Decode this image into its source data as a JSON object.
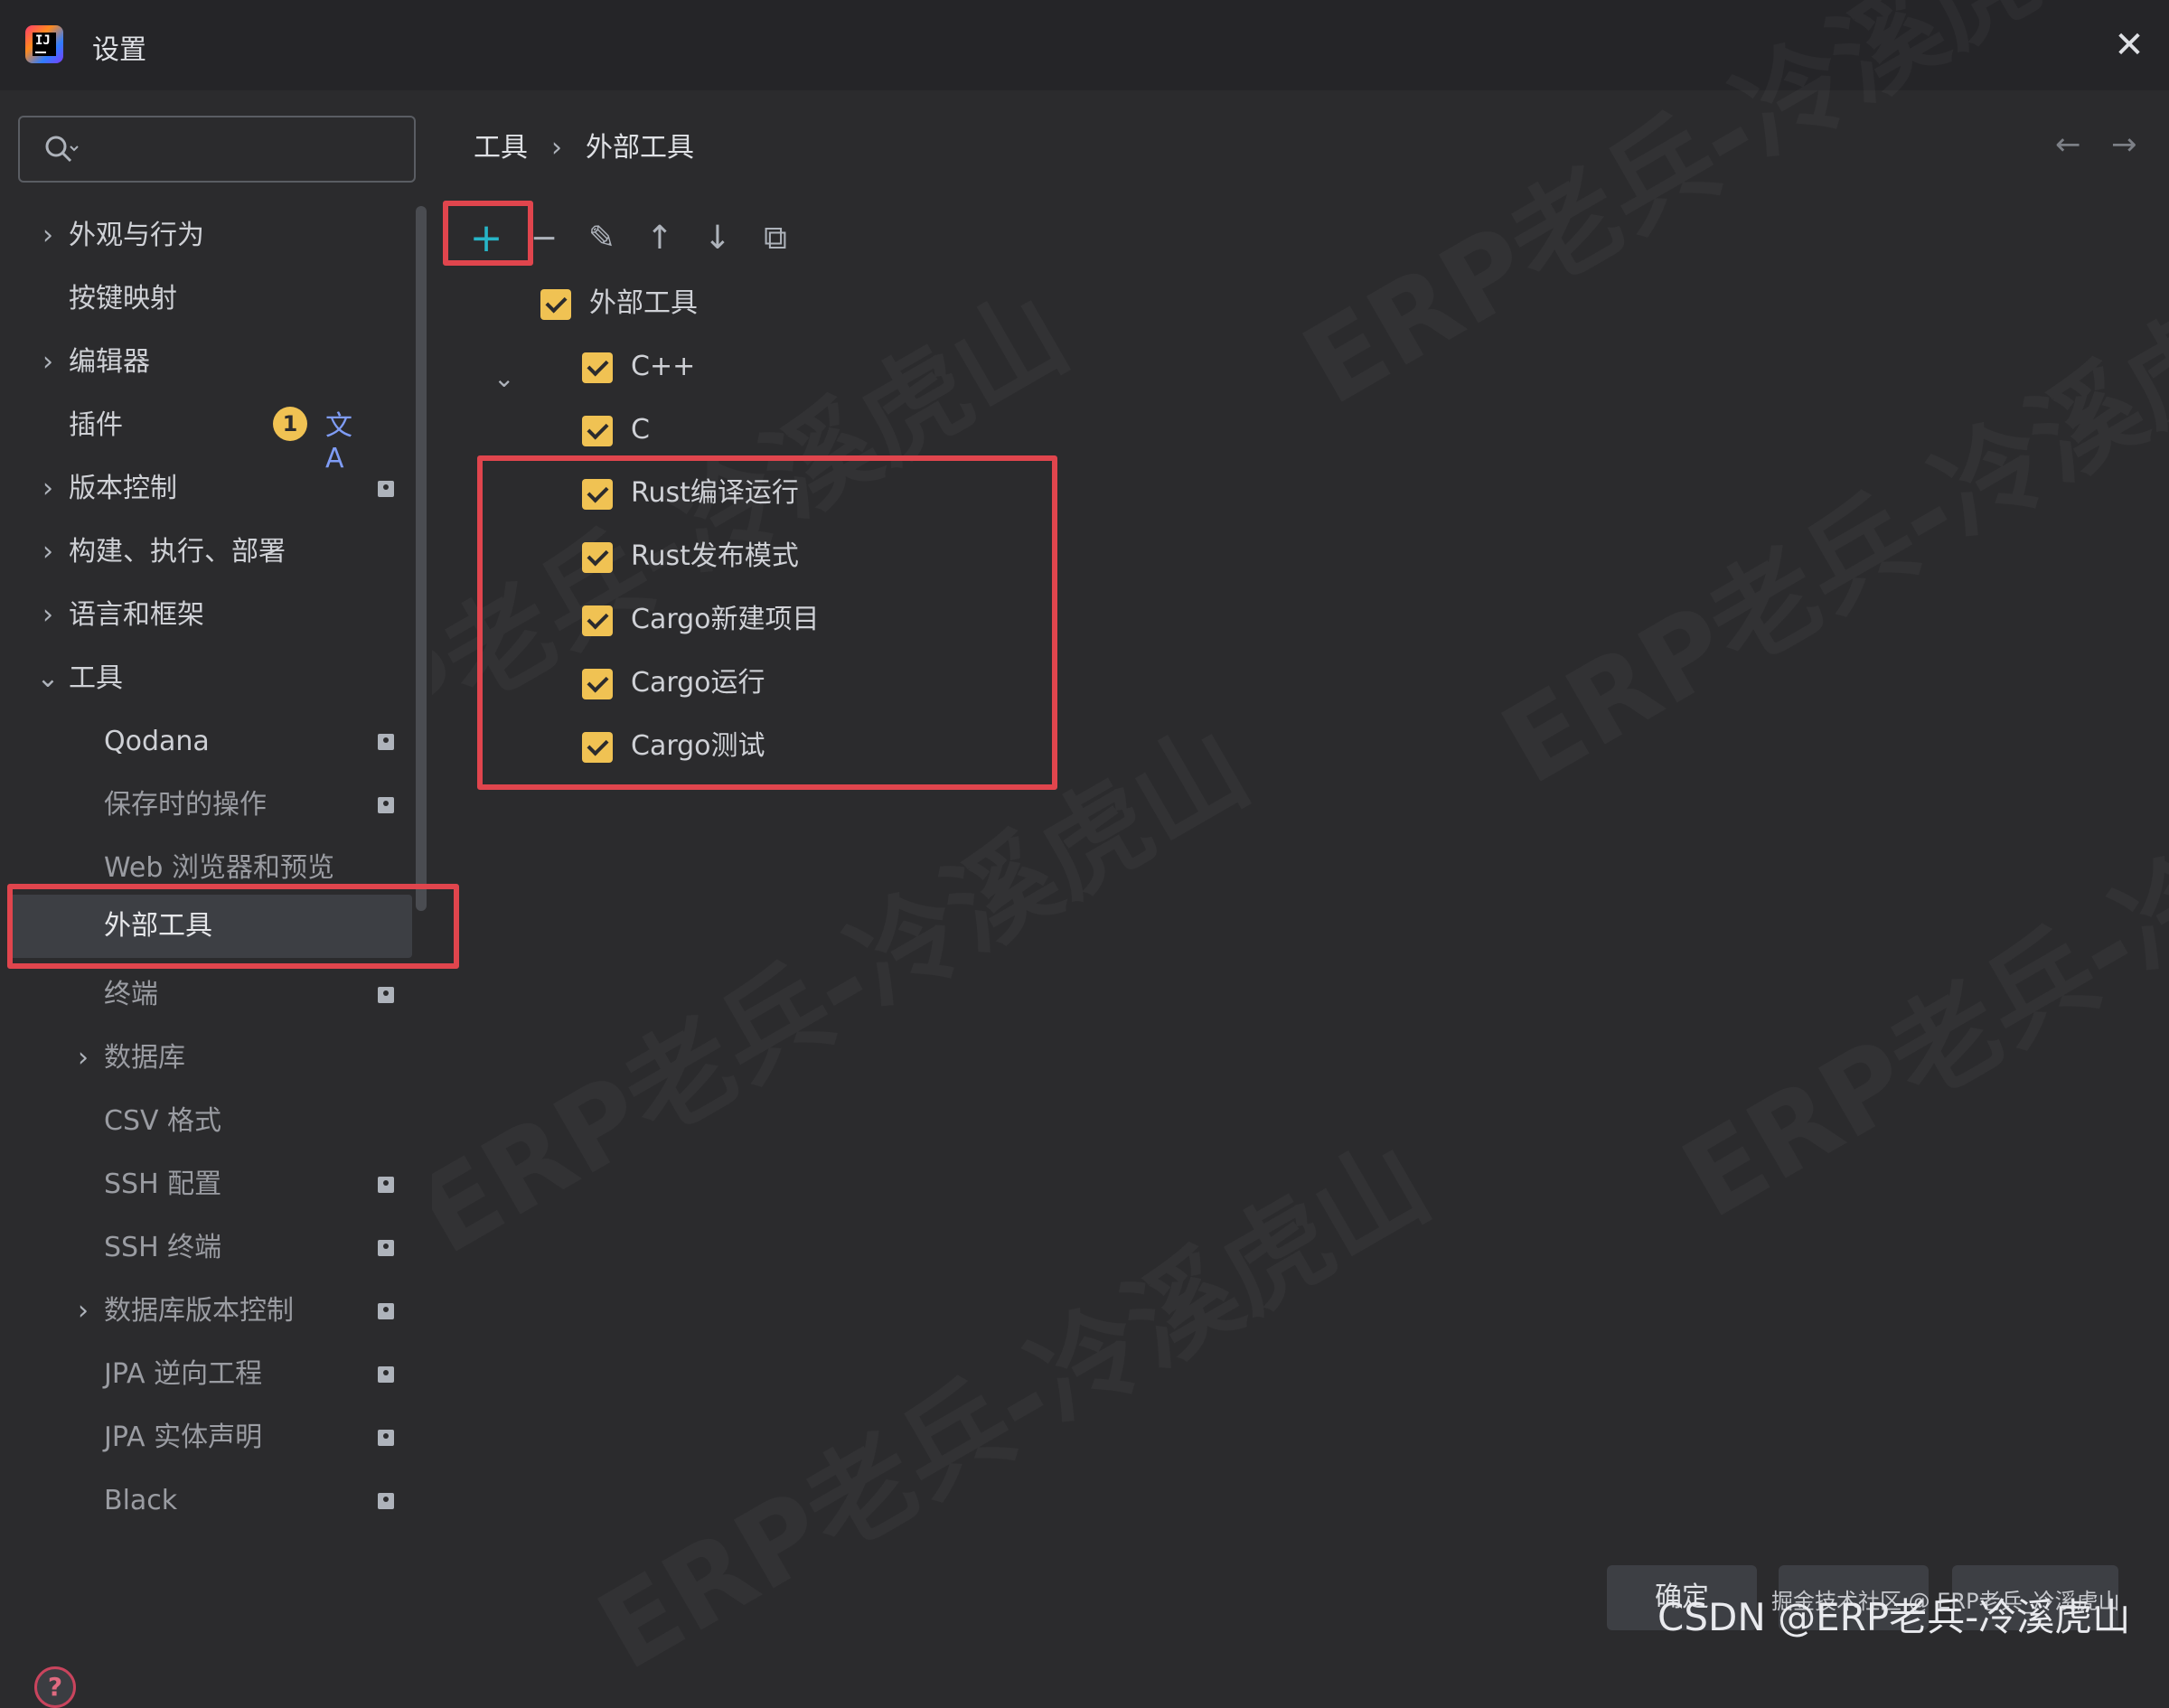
{
  "window": {
    "title": "设置",
    "close_glyph": "✕",
    "logo_text": "IJ"
  },
  "search": {
    "placeholder": "",
    "value": ""
  },
  "sidebar": {
    "items": [
      {
        "label": "外观与行为",
        "chevron": "›"
      },
      {
        "label": "按键映射"
      },
      {
        "label": "编辑器",
        "chevron": "›"
      },
      {
        "label": "插件",
        "badge": "1"
      },
      {
        "label": "版本控制",
        "chevron": "›"
      },
      {
        "label": "构建、执行、部署",
        "chevron": "›"
      },
      {
        "label": "语言和框架",
        "chevron": "›"
      },
      {
        "label": "工具",
        "chevron": "⌄"
      },
      {
        "label": "Qodana"
      },
      {
        "label": "保存时的操作"
      },
      {
        "label": "Web 浏览器和预览"
      },
      {
        "label": "外部工具"
      },
      {
        "label": "终端"
      },
      {
        "label": "数据库",
        "chevron": "›"
      },
      {
        "label": "CSV 格式"
      },
      {
        "label": "SSH 配置"
      },
      {
        "label": "SSH 终端"
      },
      {
        "label": "数据库版本控制",
        "chevron": "›"
      },
      {
        "label": "JPA 逆向工程"
      },
      {
        "label": "JPA 实体声明"
      },
      {
        "label": "Black"
      }
    ],
    "translate_glyph": "文A",
    "help_glyph": "?"
  },
  "breadcrumb": {
    "parent": "工具",
    "separator": "›",
    "current": "外部工具"
  },
  "nav": {
    "back_glyph": "←",
    "forward_glyph": "→"
  },
  "toolbar": {
    "add_glyph": "+",
    "remove_glyph": "−",
    "edit_glyph": "✎",
    "up_glyph": "↑",
    "down_glyph": "↓",
    "copy_glyph": "⧉"
  },
  "tools": {
    "group_label": "外部工具",
    "group_chevron": "⌄",
    "items": [
      "C++",
      "C",
      "Rust编译运行",
      "Rust发布模式",
      "Cargo新建项目",
      "Cargo运行",
      "Cargo测试"
    ]
  },
  "buttons": {
    "ok": "确定",
    "apply": "",
    "cancel": ""
  },
  "watermark": {
    "text": "ERP老兵-冷溪虎山",
    "footer": "CSDN @ERP老兵-冷溪虎山",
    "footer_small": "掘金技术社区 @ ERP老兵_冷溪虎山"
  },
  "colors": {
    "accent_add": "#27b5c7",
    "checkbox": "#f0c253",
    "highlight_box": "#e0454d",
    "background": "#2b2b2d"
  }
}
